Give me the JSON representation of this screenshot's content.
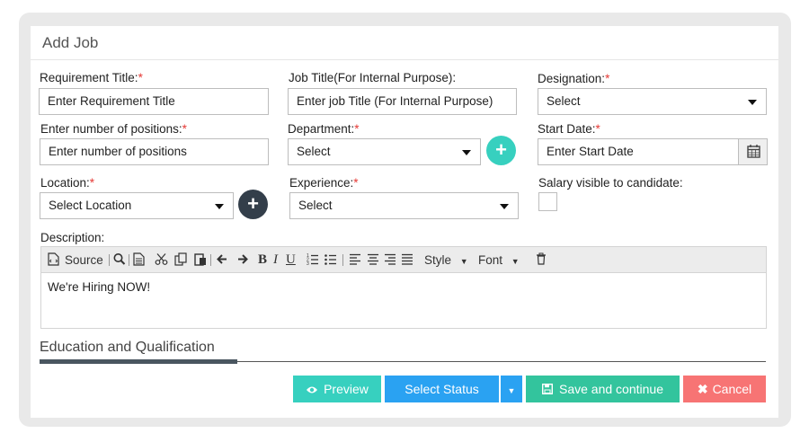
{
  "header": {
    "title": "Add Job"
  },
  "form": {
    "requirement_title": {
      "label": "Requirement Title:",
      "required": "*",
      "placeholder": "Enter Requirement Title"
    },
    "job_title": {
      "label": "Job Title(For Internal Purpose):",
      "placeholder": "Enter job Title (For Internal Purpose)"
    },
    "designation": {
      "label": "Designation:",
      "required": "*",
      "value": "Select"
    },
    "positions": {
      "label": "Enter number of positions:",
      "required": "*",
      "placeholder": "Enter number of positions"
    },
    "department": {
      "label": "Department:",
      "required": "*",
      "value": "Select"
    },
    "start_date": {
      "label": "Start Date:",
      "required": "*",
      "placeholder": "Enter Start Date"
    },
    "location": {
      "label": "Location:",
      "required": "*",
      "value": "Select Location"
    },
    "experience": {
      "label": "Experience:",
      "required": "*",
      "value": "Select"
    },
    "salary_visible": {
      "label": "Salary visible to candidate:",
      "checked": false
    },
    "description": {
      "label": "Description:",
      "content": "We're Hiring NOW!"
    }
  },
  "editor_toolbar": {
    "source": "Source",
    "style": "Style",
    "font": "Font"
  },
  "section": {
    "title": "Education and Qualification"
  },
  "actions": {
    "preview": "Preview",
    "select_status": "Select Status",
    "save_continue": "Save and continue",
    "cancel": "Cancel"
  },
  "colors": {
    "teal": "#37d0bf",
    "blue": "#2aa2f2",
    "green": "#33c49d",
    "red": "#f77474",
    "dark_button": "#333e4a"
  },
  "icons": [
    "plus-icon",
    "calendar-icon",
    "eye-icon",
    "save-icon",
    "close-icon",
    "chevron-down-icon"
  ]
}
